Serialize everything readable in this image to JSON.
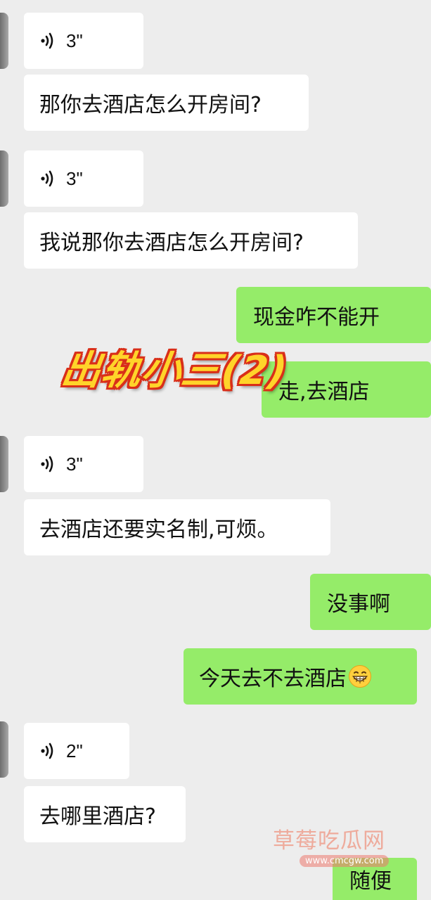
{
  "messages": [
    {
      "kind": "voice",
      "side": "in",
      "duration": "3\""
    },
    {
      "kind": "text",
      "side": "in",
      "text": "那你去酒店怎么开房间?"
    },
    {
      "kind": "voice",
      "side": "in",
      "duration": "3\""
    },
    {
      "kind": "text",
      "side": "in",
      "text": "我说那你去酒店怎么开房间?"
    },
    {
      "kind": "text",
      "side": "out",
      "text": "现金咋不能开"
    },
    {
      "kind": "text",
      "side": "out",
      "text": "走,去酒店"
    },
    {
      "kind": "voice",
      "side": "in",
      "duration": "3\""
    },
    {
      "kind": "text",
      "side": "in",
      "text": "去酒店还要实名制,可烦。"
    },
    {
      "kind": "text",
      "side": "out",
      "text": "没事啊"
    },
    {
      "kind": "text",
      "side": "out",
      "text": "今天去不去酒店",
      "emoji": "grinning-face-emoji"
    },
    {
      "kind": "voice",
      "side": "in",
      "duration": "2\""
    },
    {
      "kind": "text",
      "side": "in",
      "text": "去哪里酒店?"
    },
    {
      "kind": "text",
      "side": "out",
      "text": "随便"
    }
  ],
  "overlay": {
    "title": "出轨小三(2)"
  },
  "watermark": {
    "text": "草莓吃瓜网",
    "url": "www.cmcgw.com"
  },
  "colors": {
    "background": "#ededed",
    "incoming_bubble": "#ffffff",
    "outgoing_bubble": "#95ec69",
    "overlay_fill": "#ffd42a",
    "overlay_stroke": "#d92f19"
  },
  "icons": {
    "voice": "voice-wave-icon",
    "avatar": "avatar"
  }
}
